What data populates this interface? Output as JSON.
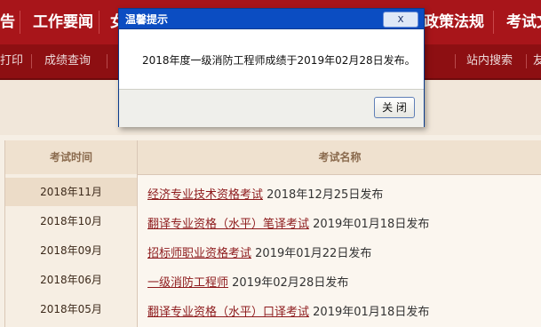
{
  "nav": {
    "items": [
      "告",
      "工作要闻",
      "女",
      "政策法规",
      "考试文"
    ]
  },
  "subnav": {
    "items": [
      "打印",
      "成绩查询",
      "站内搜索",
      "友"
    ]
  },
  "table": {
    "headers": {
      "time": "考试时间",
      "name": "考试名称"
    },
    "months": [
      "2018年11月",
      "2018年10月",
      "2018年09月",
      "2018年06月",
      "2018年05月"
    ],
    "rows": [
      {
        "title": "经济专业技术资格考试",
        "note": "2018年12月25日发布"
      },
      {
        "title": "翻译专业资格（水平）笔译考试",
        "note": "2019年01月18日发布"
      },
      {
        "title": "招标师职业资格考试",
        "note": "2019年01月22日发布"
      },
      {
        "title": "一级消防工程师",
        "note": "2019年02月28日发布"
      },
      {
        "title": "翻译专业资格（水平）口译考试",
        "note": "2019年01月18日发布"
      }
    ]
  },
  "dialog": {
    "title": "温馨提示",
    "close_glyph": "x",
    "message": "2018年度一级消防工程师成绩于2019年02月28日发布。",
    "button": "关 闭"
  },
  "colors": {
    "nav": "#a8151a",
    "subnav": "#8d0f12",
    "dialog_title": "#0b4dc2",
    "link": "#8d1a1c"
  }
}
